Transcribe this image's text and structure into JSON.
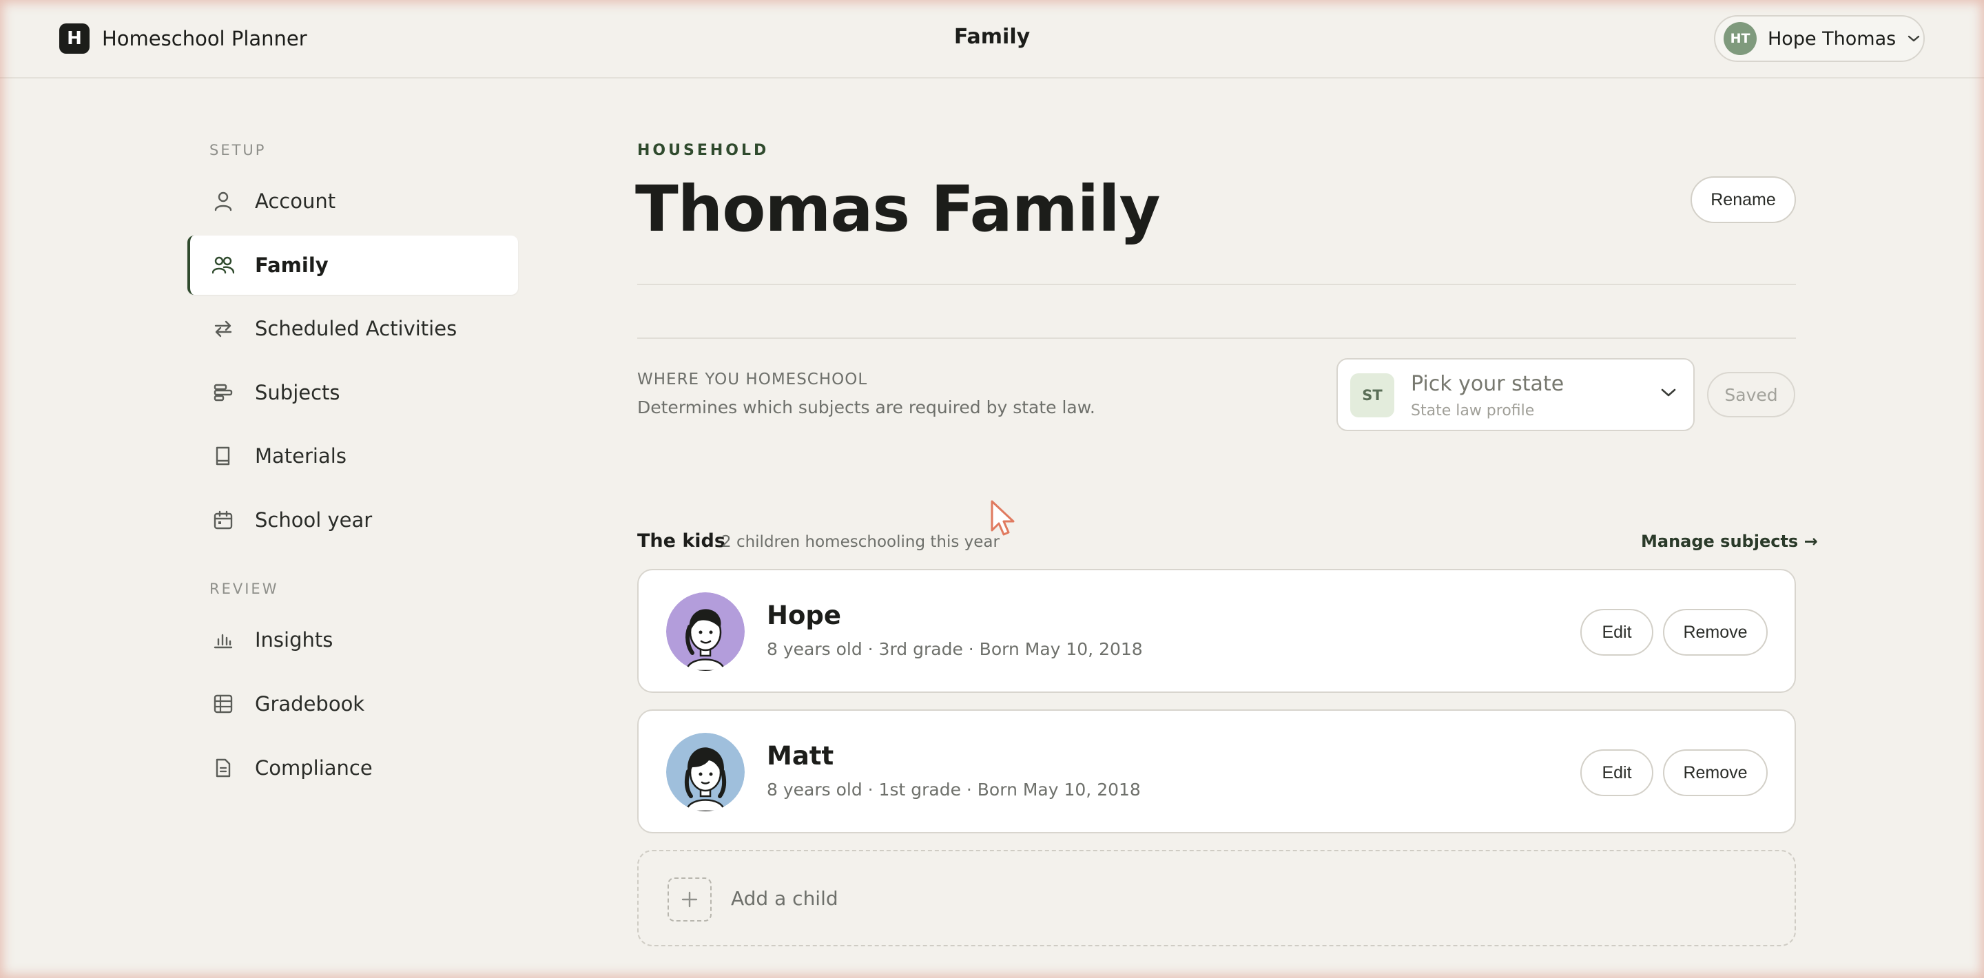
{
  "app": {
    "logo_letter": "H",
    "name": "Homeschool Planner"
  },
  "header": {
    "title": "Family"
  },
  "user": {
    "initials": "HT",
    "name": "Hope Thomas"
  },
  "sidebar": {
    "setup_heading": "SETUP",
    "review_heading": "REVIEW",
    "setup_items": [
      {
        "label": "Account",
        "icon": "person-icon"
      },
      {
        "label": "Family",
        "icon": "people-icon",
        "active": true
      },
      {
        "label": "Scheduled Activities",
        "icon": "repeat-icon"
      },
      {
        "label": "Subjects",
        "icon": "subjects-icon"
      },
      {
        "label": "Materials",
        "icon": "book-icon"
      },
      {
        "label": "School year",
        "icon": "calendar-icon"
      }
    ],
    "review_items": [
      {
        "label": "Insights",
        "icon": "bar-chart-icon"
      },
      {
        "label": "Gradebook",
        "icon": "gradebook-icon"
      },
      {
        "label": "Compliance",
        "icon": "document-icon"
      }
    ]
  },
  "household": {
    "eyebrow": "HOUSEHOLD",
    "title": "Thomas Family",
    "rename_label": "Rename"
  },
  "where": {
    "label": "WHERE YOU HOMESCHOOL",
    "description": "Determines which subjects are required by state law.",
    "state_badge": "ST",
    "state_placeholder": "Pick your state",
    "state_sub": "State law profile",
    "saved_label": "Saved"
  },
  "kids": {
    "title": "The kids",
    "subtitle": "2 children homeschooling this year",
    "manage_label": "Manage subjects →",
    "edit_label": "Edit",
    "remove_label": "Remove",
    "list": [
      {
        "name": "Hope",
        "meta": "8 years old · 3rd grade · Born May 10, 2018",
        "avatar_color": "#b39ddb"
      },
      {
        "name": "Matt",
        "meta": "8 years old · 1st grade · Born May 10, 2018",
        "avatar_color": "#9fbfdc"
      }
    ],
    "add_label": "Add a child"
  }
}
